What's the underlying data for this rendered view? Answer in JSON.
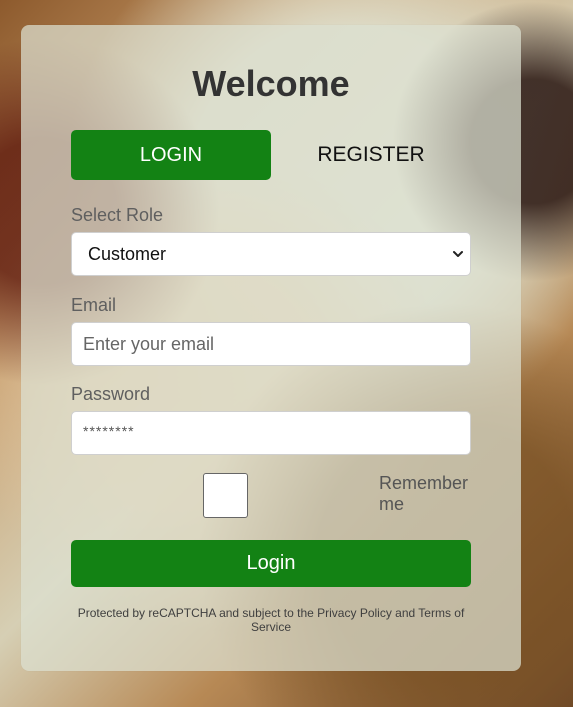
{
  "page": {
    "title": "Welcome"
  },
  "tabs": {
    "login": "LOGIN",
    "register": "REGISTER"
  },
  "form": {
    "role_label": "Select Role",
    "role_value": "Customer",
    "email_label": "Email",
    "email_placeholder": "Enter your email",
    "password_label": "Password",
    "password_value": "********",
    "remember_label": "Remember me",
    "login_button": "Login"
  },
  "footer": {
    "text": "Protected by reCAPTCHA and subject to the Privacy Policy and Terms of Service"
  },
  "icons": {
    "select_chevron": "chevron-down-icon"
  },
  "colors": {
    "primary_green": "#138214",
    "card_bg": "#dde1d1"
  }
}
